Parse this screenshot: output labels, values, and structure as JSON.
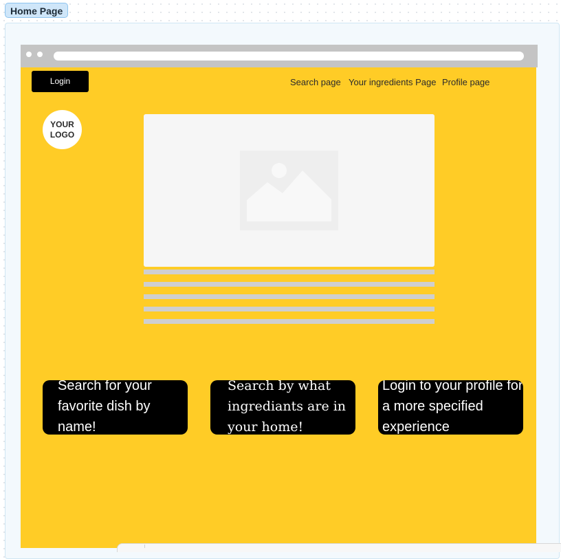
{
  "frame": {
    "label": "Home Page"
  },
  "browser": {
    "dots": [
      "window-dot",
      "window-dot"
    ]
  },
  "header": {
    "login_label": "Login",
    "nav": [
      {
        "label": "Search page"
      },
      {
        "label": "Your ingredients Page"
      },
      {
        "label": "Profile page"
      }
    ]
  },
  "logo": {
    "text": "YOUR LOGO"
  },
  "hero": {
    "icon": "image-placeholder-icon"
  },
  "cards": [
    {
      "text": "Search for your favorite dish by name!"
    },
    {
      "text": "Search by what ingrediants are in your home!"
    },
    {
      "text": "Login to your profile for a more specified experience"
    }
  ],
  "colors": {
    "page_background": "#ffcc26",
    "card_background": "#000000",
    "text_on_card": "#ffffff",
    "browser_bar": "#c4c4c4",
    "frame_tag": "#cfe6f9"
  }
}
